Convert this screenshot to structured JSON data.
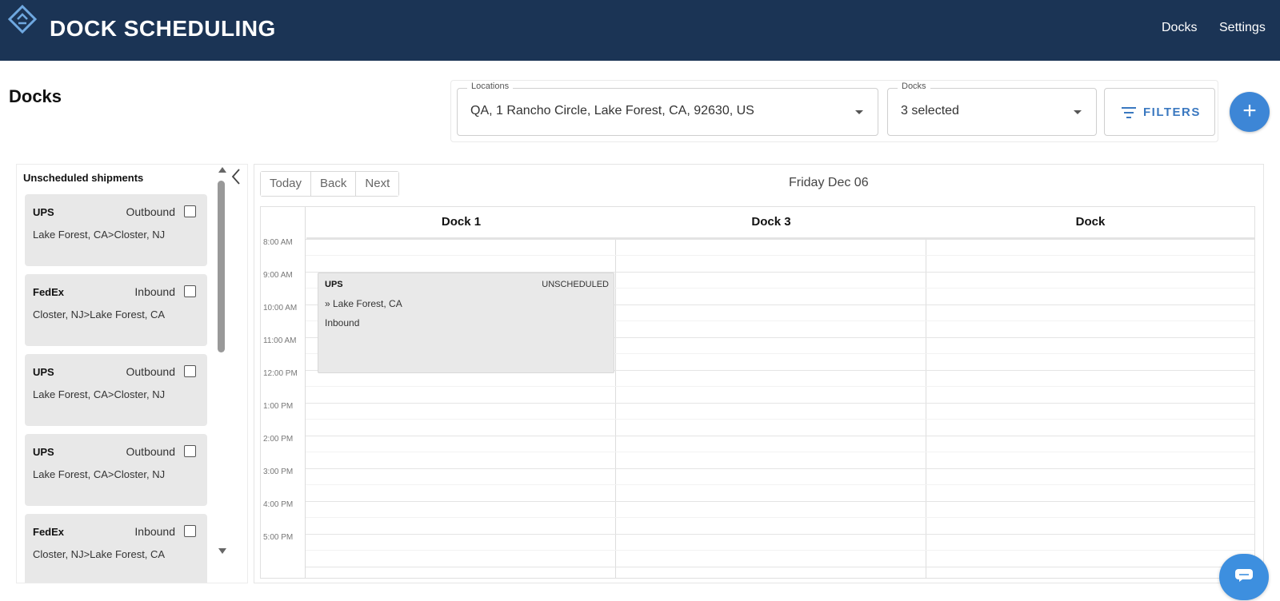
{
  "header": {
    "app_title": "DOCK SCHEDULING",
    "nav": [
      {
        "label": "Docks"
      },
      {
        "label": "Settings"
      }
    ],
    "bar_color": "#1b3455"
  },
  "page": {
    "title": "Docks"
  },
  "filters": {
    "locations": {
      "label": "Locations",
      "value": "QA, 1 Rancho Circle, Lake Forest, CA, 92630, US"
    },
    "docks": {
      "label": "Docks",
      "value": "3 selected"
    },
    "filters_button_label": "FILTERS",
    "add_button_label": "+",
    "accent_color": "#3d86d6"
  },
  "unscheduled": {
    "title": "Unscheduled shipments",
    "shipments": [
      {
        "carrier": "UPS",
        "direction": "Outbound",
        "route": "Lake Forest, CA>Closter, NJ"
      },
      {
        "carrier": "FedEx",
        "direction": "Inbound",
        "route": "Closter, NJ>Lake Forest, CA"
      },
      {
        "carrier": "UPS",
        "direction": "Outbound",
        "route": "Lake Forest, CA>Closter, NJ"
      },
      {
        "carrier": "UPS",
        "direction": "Outbound",
        "route": "Lake Forest, CA>Closter, NJ"
      },
      {
        "carrier": "FedEx",
        "direction": "Inbound",
        "route": "Closter, NJ>Lake Forest, CA"
      }
    ]
  },
  "calendar": {
    "buttons": {
      "today": "Today",
      "back": "Back",
      "next": "Next"
    },
    "date_label": "Friday Dec 06",
    "columns": [
      {
        "label": "Dock 1"
      },
      {
        "label": "Dock 3"
      },
      {
        "label": "Dock"
      }
    ],
    "times": [
      "8:00 AM",
      "9:00 AM",
      "10:00 AM",
      "11:00 AM",
      "12:00 PM",
      "1:00 PM",
      "2:00 PM",
      "3:00 PM",
      "4:00 PM",
      "5:00 PM"
    ],
    "event": {
      "carrier": "UPS",
      "status": "UNSCHEDULED",
      "route": "» Lake Forest, CA",
      "direction": "Inbound",
      "column": "Dock 1",
      "start": "9:00 AM",
      "end": "12:00 PM"
    }
  }
}
